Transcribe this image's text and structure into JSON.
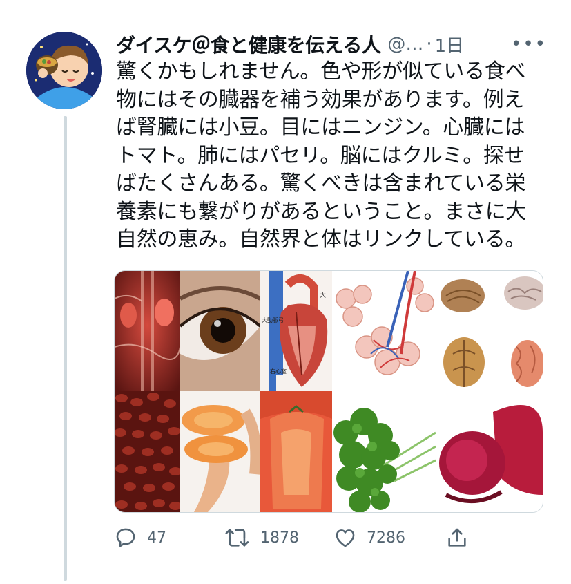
{
  "tweet": {
    "author_name": "ダイスケ＠食と健康を伝える人",
    "handle": "@…",
    "separator": "·",
    "time": "1日",
    "more_label": "•••",
    "text": "驚くかもしれません。色や形が似ている食べ\n物にはその臓器を補う効果があります。例え\nば腎臓には小豆。目にはニンジン。心臓には\nトマト。肺にはパセリ。脳にはクルミ。探せ\nばたくさんある。驚くべきは含まれている栄\n養素にも繋がりがあるということ。まさに大\n自然の恵み。自然界と体はリンクしている。"
  },
  "media": {
    "heart_labels": [
      "大",
      "大動脈弓",
      "右心室"
    ]
  },
  "actions": {
    "reply_count": "47",
    "retweet_count": "1878",
    "like_count": "7286"
  },
  "icons": {
    "reply": "reply-icon",
    "retweet": "retweet-icon",
    "like": "heart-icon",
    "share": "share-icon",
    "more": "more-icon"
  },
  "colors": {
    "secondary_text": "#536471",
    "thread_line": "#cfd9de",
    "border": "#cfd9de"
  }
}
